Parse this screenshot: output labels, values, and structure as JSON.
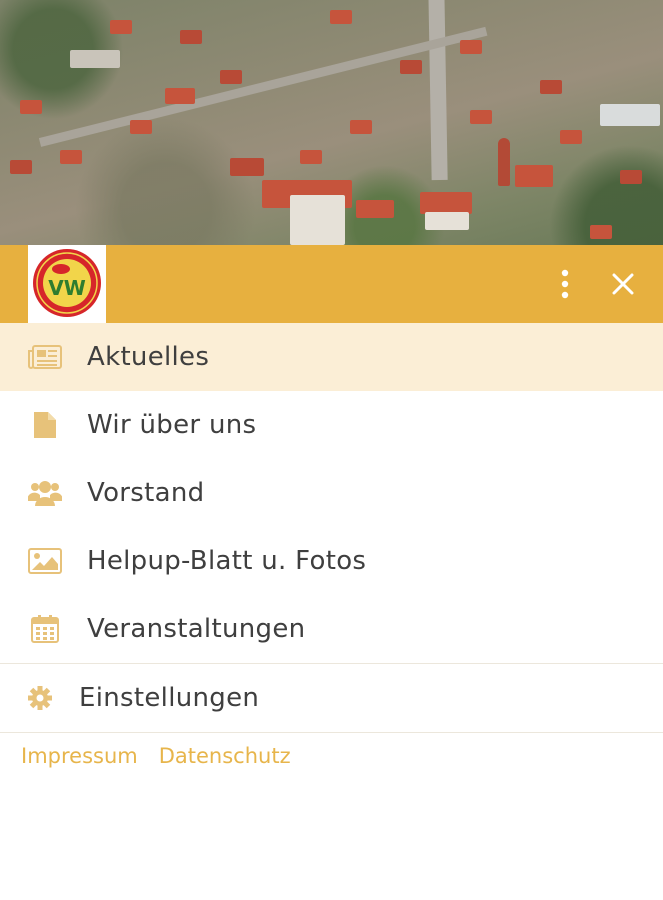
{
  "header": {
    "logo_text": "VW",
    "logo_ring_text": "VERKEHRSVEREIN HELPUP",
    "accent_color": "#e7b03f",
    "logo_alt": "club-logo"
  },
  "menu": {
    "items": [
      {
        "label": "Aktuelles",
        "icon": "newspaper-icon",
        "active": true
      },
      {
        "label": "Wir über uns",
        "icon": "document-icon",
        "active": false
      },
      {
        "label": "Vorstand",
        "icon": "users-icon",
        "active": false
      },
      {
        "label": "Helpup-Blatt u. Fotos",
        "icon": "image-icon",
        "active": false
      },
      {
        "label": "Veranstaltungen",
        "icon": "calendar-icon",
        "active": false
      }
    ],
    "settings": {
      "label": "Einstellungen",
      "icon": "gear-icon"
    }
  },
  "footer": {
    "impressum": "Impressum",
    "datenschutz": "Datenschutz"
  },
  "colors": {
    "icon": "#e7c27a",
    "active_bg": "#fbeed6",
    "link": "#e7b54b"
  }
}
